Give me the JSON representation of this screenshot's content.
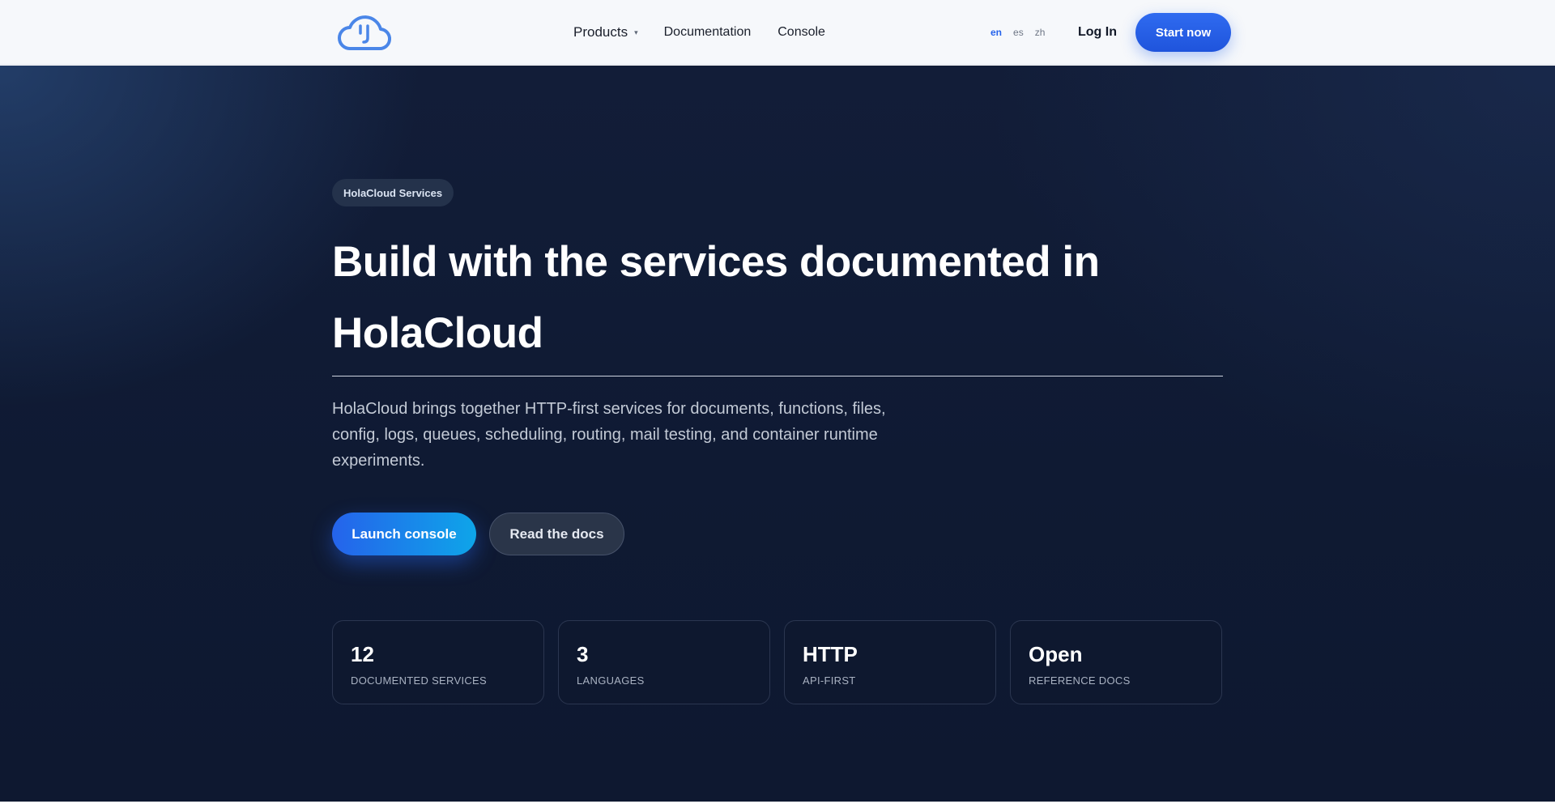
{
  "header": {
    "nav": {
      "products": "Products",
      "products_caret": "▾",
      "documentation": "Documentation",
      "console": "Console"
    },
    "languages": [
      "en",
      "es",
      "zh"
    ],
    "active_language": "en",
    "login": "Log In",
    "start_now": "Start now"
  },
  "hero": {
    "badge": "HolaCloud Services",
    "headline": "Build with the services documented in HolaCloud",
    "description": "HolaCloud brings together HTTP-first services for documents, functions, files, config, logs, queues, scheduling, routing, mail testing, and container runtime experiments.",
    "primary_cta": "Launch console",
    "secondary_cta": "Read the docs",
    "stats": [
      {
        "value": "12",
        "label": "DOCUMENTED SERVICES"
      },
      {
        "value": "3",
        "label": "LANGUAGES"
      },
      {
        "value": "HTTP",
        "label": "API-FIRST"
      },
      {
        "value": "Open",
        "label": "REFERENCE DOCS"
      }
    ]
  },
  "colors": {
    "accent": "#2563eb",
    "accent_light": "#0ea5e9",
    "hero_background": "#0f1a33",
    "header_background": "#f6f8fb",
    "logo": "#4a86e8"
  },
  "icons": {
    "logo": "cloud-smile-icon",
    "products_caret": "chevron-down-icon"
  }
}
